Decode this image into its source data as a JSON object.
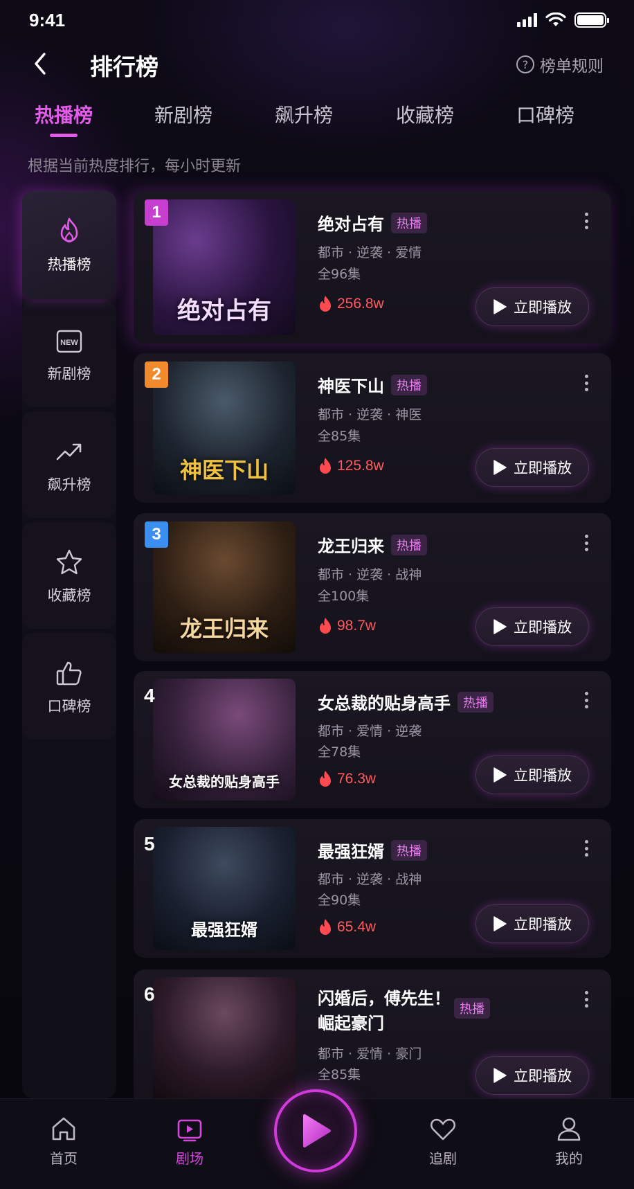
{
  "status_bar": {
    "time": "9:41"
  },
  "header": {
    "title": "排行榜",
    "rules_label": "榜单规则",
    "rules_icon_glyph": "?"
  },
  "tabs": [
    {
      "label": "热播榜",
      "active": true
    },
    {
      "label": "新剧榜",
      "active": false
    },
    {
      "label": "飙升榜",
      "active": false
    },
    {
      "label": "收藏榜",
      "active": false
    },
    {
      "label": "口碑榜",
      "active": false
    }
  ],
  "subtitle": "根据当前热度排行，每小时更新",
  "sidebar": [
    {
      "label": "热播榜",
      "icon": "flame-icon",
      "active": true
    },
    {
      "label": "新剧榜",
      "icon": "new-icon",
      "icon_text": "NEW",
      "active": false
    },
    {
      "label": "飙升榜",
      "icon": "trending-up-icon",
      "active": false
    },
    {
      "label": "收藏榜",
      "icon": "star-icon",
      "active": false
    },
    {
      "label": "口碑榜",
      "icon": "thumbs-up-icon",
      "active": false
    }
  ],
  "list": [
    {
      "rank": "1",
      "badge_color": "#c63fce",
      "title": "绝对占有",
      "tag": "热播",
      "genres": "都市 · 逆袭 · 爱情",
      "episodes": "全96集",
      "heat": "256.8w",
      "play_label": "立即播放",
      "poster_title": "绝对占有"
    },
    {
      "rank": "2",
      "badge_color": "#f08a2c",
      "title": "神医下山",
      "tag": "热播",
      "genres": "都市 · 逆袭 · 神医",
      "episodes": "全85集",
      "heat": "125.8w",
      "play_label": "立即播放",
      "poster_title": "神医下山"
    },
    {
      "rank": "3",
      "badge_color": "#3b8ff0",
      "title": "龙王归来",
      "tag": "热播",
      "genres": "都市 · 逆袭 · 战神",
      "episodes": "全100集",
      "heat": "98.7w",
      "play_label": "立即播放",
      "poster_title": "龙王归来"
    },
    {
      "rank": "4",
      "title": "女总裁的贴身高手",
      "tag": "热播",
      "genres": "都市 · 爱情 · 逆袭",
      "episodes": "全78集",
      "heat": "76.3w",
      "play_label": "立即播放",
      "poster_title": "女总裁的贴身高手"
    },
    {
      "rank": "5",
      "title": "最强狂婿",
      "tag": "热播",
      "genres": "都市 · 逆袭 · 战神",
      "episodes": "全90集",
      "heat": "65.4w",
      "play_label": "立即播放",
      "poster_title": "最强狂婿"
    },
    {
      "rank": "6",
      "title_line1": "闪婚后，傅先生！",
      "title_line2": "崛起豪门",
      "tag": "热播",
      "genres": "都市 · 爱情 · 豪门",
      "episodes": "全85集",
      "play_label": "立即播放"
    }
  ],
  "tabbar": [
    {
      "label": "首页",
      "icon": "home-icon",
      "active": false
    },
    {
      "label": "剧场",
      "icon": "theater-icon",
      "active": true
    },
    {
      "label": "追剧",
      "icon": "heart-icon",
      "active": false
    },
    {
      "label": "我的",
      "icon": "profile-icon",
      "active": false
    }
  ],
  "colors": {
    "accent": "#e35ce8",
    "heat": "#ff5a5f",
    "background": "#0a0810"
  }
}
